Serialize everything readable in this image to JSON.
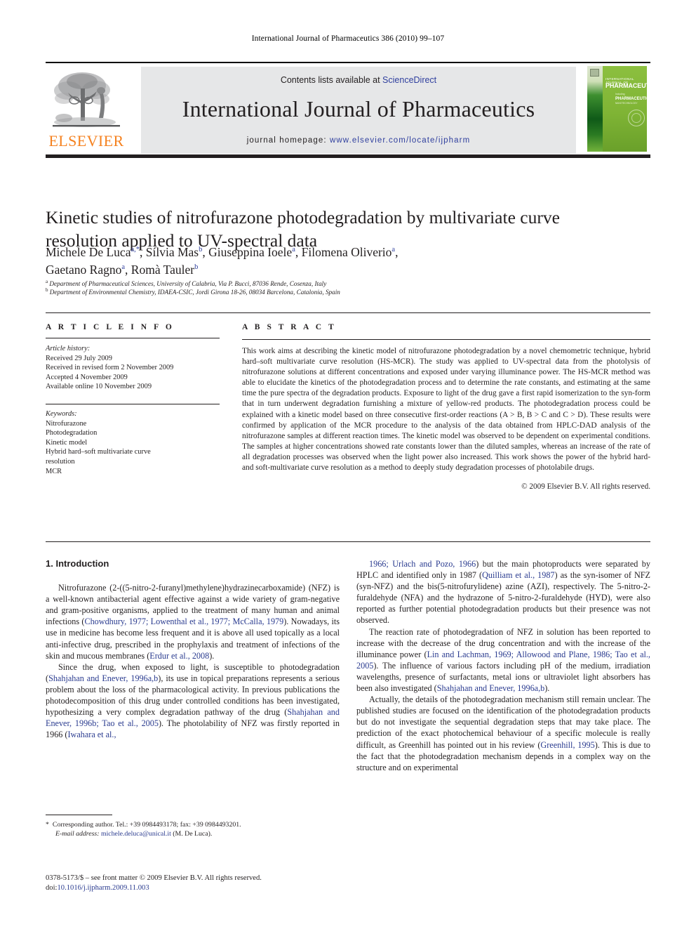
{
  "running_head": "International Journal of Pharmaceutics 386 (2010) 99–107",
  "masthead": {
    "publisher_wordmark": "ELSEVIER",
    "contents_prefix": "Contents lists available at ",
    "contents_link": "ScienceDirect",
    "journal_title": "International Journal of Pharmaceutics",
    "homepage_label": "journal homepage: ",
    "homepage_url": "www.elsevier.com/locate/ijpharm",
    "cover": {
      "line1": "INTERNATIONAL JOURNAL OF",
      "line2": "PHARMACEUTICS",
      "line3": "Including",
      "line4": "PHARMACEUTICAL",
      "line5": "NANOTECHNOLOGY"
    }
  },
  "article": {
    "title": "Kinetic studies of nitrofurazone photodegradation by multivariate curve resolution applied to UV-spectral data",
    "authors_line1": "Michele De Luca",
    "authors_line1_sup": "a,*",
    "authors_mid": ", Sílvia Mas",
    "authors_mid_sup": "b",
    "authors_mid2": ", Giuseppina Ioele",
    "authors_mid2_sup": "a",
    "authors_mid3": ", Filomena Oliverio",
    "authors_mid3_sup": "a",
    "authors_comma": ",",
    "authors_line2": "Gaetano Ragno",
    "authors_line2_sup": "a",
    "authors_line2b": ", Romà Tauler",
    "authors_line2b_sup": "b",
    "affiliation_a_sup": "a",
    "affiliation_a": "Department of Pharmaceutical Sciences, University of Calabria, Via P. Bucci, 87036 Rende, Cosenza, Italy",
    "affiliation_b_sup": "b",
    "affiliation_b": "Department of Environmental Chemistry, IDAEA-CSIC, Jordi Girona 18-26, 08034 Barcelona, Catalonia, Spain"
  },
  "article_info": {
    "heading": "A R T I C L E   I N F O",
    "history_label": "Article history:",
    "history": [
      "Received 29 July 2009",
      "Received in revised form 2 November 2009",
      "Accepted 4 November 2009",
      "Available online 10 November 2009"
    ],
    "keywords_label": "Keywords:",
    "keywords": [
      "Nitrofurazone",
      "Photodegradation",
      "Kinetic model",
      "Hybrid hard–soft multivariate curve",
      "resolution",
      "MCR"
    ]
  },
  "abstract": {
    "heading": "A B S T R A C T",
    "text": "This work aims at describing the kinetic model of nitrofurazone photodegradation by a novel chemometric technique, hybrid hard–soft multivariate curve resolution (HS-MCR). The study was applied to UV-spectral data from the photolysis of nitrofurazone solutions at different concentrations and exposed under varying illuminance power. The HS-MCR method was able to elucidate the kinetics of the photodegradation process and to determine the rate constants, and estimating at the same time the pure spectra of the degradation products. Exposure to light of the drug gave a first rapid isomerization to the syn-form that in turn underwent degradation furnishing a mixture of yellow-red products. The photodegradation process could be explained with a kinetic model based on three consecutive first-order reactions (A > B, B > C and C > D). These results were confirmed by application of the MCR procedure to the analysis of the data obtained from HPLC-DAD analysis of the nitrofurazone samples at different reaction times. The kinetic model was observed to be dependent on experimental conditions. The samples at higher concentrations showed rate constants lower than the diluted samples, whereas an increase of the rate of all degradation processes was observed when the light power also increased. This work shows the power of the hybrid hard- and soft-multivariate curve resolution as a method to deeply study degradation processes of photolabile drugs.",
    "copyright": "© 2009 Elsevier B.V. All rights reserved."
  },
  "body": {
    "section_heading": "1.  Introduction",
    "left_paragraphs": [
      [
        {
          "t": "Nitrofurazone (2-((5-nitro-2-furanyl)methylene)hydrazinecarboxamide) (NFZ) is a well-known antibacterial agent effective against a wide variety of gram-negative and gram-positive organisms, applied to the treatment of many human and animal infections (",
          "link": false
        },
        {
          "t": "Chowdhury, 1977; Lowenthal et al., 1977; McCalla, 1979",
          "link": true
        },
        {
          "t": "). Nowadays, its use in medicine has become less frequent and it is above all used topically as a local anti-infective drug, prescribed in the prophylaxis and treatment of infections of the skin and mucous membranes (",
          "link": false
        },
        {
          "t": "Erdur et al., 2008",
          "link": true
        },
        {
          "t": ").",
          "link": false
        }
      ],
      [
        {
          "t": "Since the drug, when exposed to light, is susceptible to photodegradation (",
          "link": false
        },
        {
          "t": "Shahjahan and Enever, 1996a,b",
          "link": true
        },
        {
          "t": "), its use in topical preparations represents a serious problem about the loss of the pharmacological activity. In previous publications the photodecomposition of this drug under controlled conditions has been investigated, hypothesizing a very complex degradation pathway of the drug (",
          "link": false
        },
        {
          "t": "Shahjahan and Enever, 1996b; Tao et al., 2005",
          "link": true
        },
        {
          "t": "). The photolability of NFZ was firstly reported in 1966 (",
          "link": false
        },
        {
          "t": "Iwahara et al.,",
          "link": true
        }
      ]
    ],
    "right_paragraphs": [
      [
        {
          "t": "1966; Urlach and Pozo, 1966",
          "link": true
        },
        {
          "t": ") but the main photoproducts were separated by HPLC and identified only in 1987 (",
          "link": false
        },
        {
          "t": "Quilliam et al., 1987",
          "link": true
        },
        {
          "t": ") as the syn-isomer of NFZ (syn-NFZ) and the bis(5-nitrofurylidene) azine (AZI), respectively. The 5-nitro-2-furaldehyde (NFA) and the hydrazone of 5-nitro-2-furaldehyde (HYD), were also reported as further potential photodegradation products but their presence was not observed.",
          "link": false
        }
      ],
      [
        {
          "t": "The reaction rate of photodegradation of NFZ in solution has been reported to increase with the decrease of the drug concentration and with the increase of the illuminance power (",
          "link": false
        },
        {
          "t": "Lin and Lachman, 1969; Allowood and Plane, 1986; Tao et al., 2005",
          "link": true
        },
        {
          "t": "). The influence of various factors including pH of the medium, irradiation wavelengths, presence of surfactants, metal ions or ultraviolet light absorbers has been also investigated (",
          "link": false
        },
        {
          "t": "Shahjahan and Enever, 1996a,b",
          "link": true
        },
        {
          "t": ").",
          "link": false
        }
      ],
      [
        {
          "t": "Actually, the details of the photodegradation mechanism still remain unclear. The published studies are focused on the identification of the photodegradation products but do not investigate the sequential degradation steps that may take place. The prediction of the exact photochemical behaviour of a specific molecule is really difficult, as Greenhill has pointed out in his review (",
          "link": false
        },
        {
          "t": "Greenhill, 1995",
          "link": true
        },
        {
          "t": "). This is due to the fact that the photodegradation mechanism depends in a complex way on the structure and on experimental",
          "link": false
        }
      ]
    ]
  },
  "footnote": {
    "star": "*",
    "corresponding": "Corresponding author. Tel.: +39 0984493178; fax: +39 0984493201.",
    "email_label": "E-mail address:",
    "email": "michele.deluca@unical.it",
    "email_suffix": "(M. De Luca)."
  },
  "footer": {
    "issn_line": "0378-5173/$ – see front matter © 2009 Elsevier B.V. All rights reserved.",
    "doi_label": "doi:",
    "doi_value": "10.1016/j.ijpharm.2009.11.003"
  }
}
